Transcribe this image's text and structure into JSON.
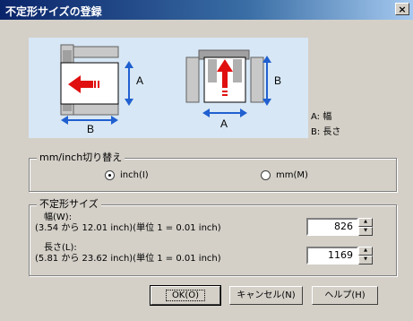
{
  "window": {
    "title": "不定形サイズの登録",
    "close_label": "×"
  },
  "diagram": {
    "label_a_left": "A",
    "label_b_left": "B",
    "label_a_right": "A",
    "label_b_right": "B",
    "legend_a": "A: 幅",
    "legend_b": "B: 長さ"
  },
  "units": {
    "group_title": "mm/inch切り替え",
    "options": [
      {
        "label": "inch(I)",
        "selected": true
      },
      {
        "label": "mm(M)",
        "selected": false
      }
    ]
  },
  "size": {
    "group_title": "不定形サイズ",
    "width_label": "幅(W):",
    "width_range": "(3.54 から 12.01 inch)(単位 1 = 0.01 inch)",
    "width_value": "826",
    "length_label": "長さ(L):",
    "length_range": "(5.81 から 23.62 inch)(単位 1 = 0.01 inch)",
    "length_value": "1169"
  },
  "buttons": {
    "ok": "OK(O)",
    "cancel": "キャンセル(N)",
    "help": "ヘルプ(H)"
  },
  "colors": {
    "title_bar": "#0a246a",
    "dialog_bg": "#d4d0c8",
    "diagram_bg": "#d7e7f5",
    "arrow_red": "#e01010",
    "arrow_blue": "#2060d0"
  }
}
